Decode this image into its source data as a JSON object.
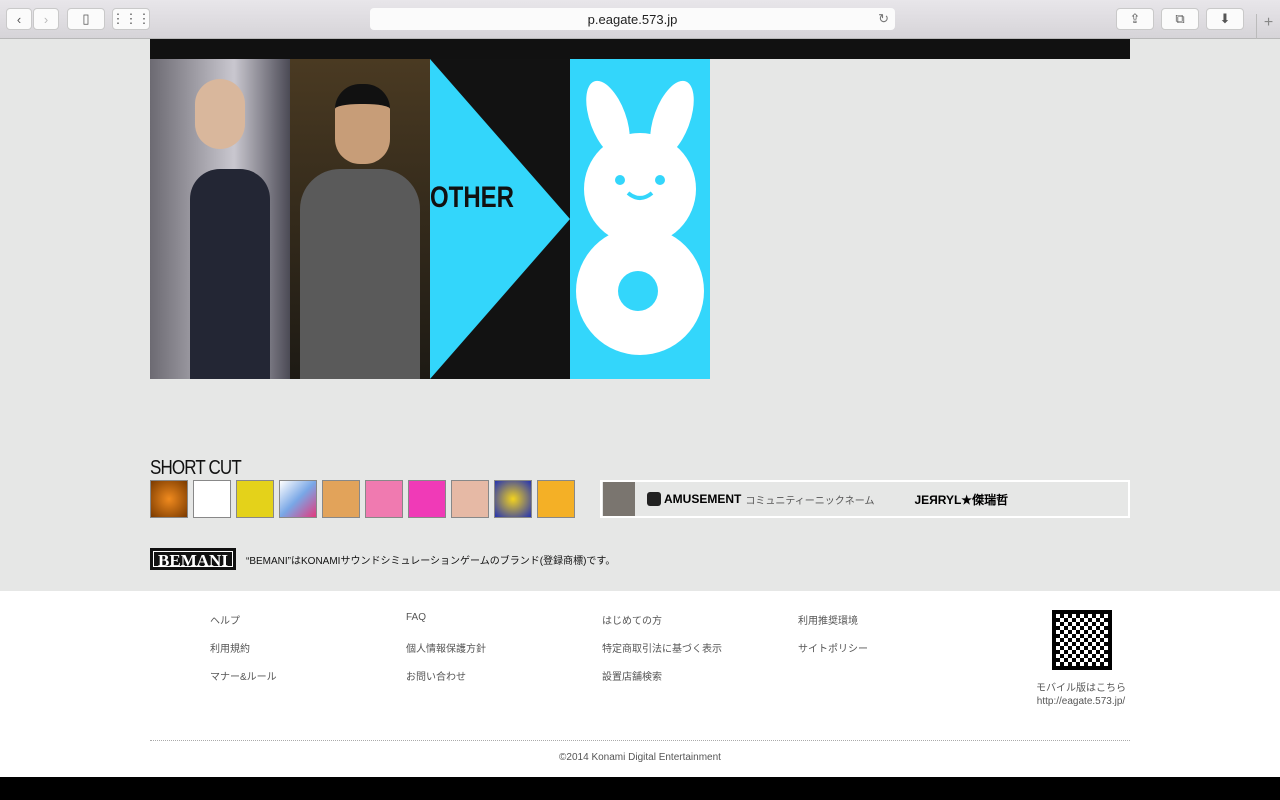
{
  "browser": {
    "url": "p.eagate.573.jp"
  },
  "banner": {
    "other_label": "OTHER"
  },
  "shortcut": {
    "title": "SHORT CUT",
    "icons": [
      "iidx",
      "ddr",
      "popn-mouse",
      "reflec-beat",
      "gitadora-girl",
      "sound-voltex",
      "jubeat-girl",
      "dance-evolution",
      "taiko-drumania",
      "nostalgia-girl"
    ],
    "amusement_logo": "AMUSEMENT",
    "nickname_label": "コミュニティーニックネーム",
    "nickname": "JEЯRYL★傑瑞哲"
  },
  "bemani": {
    "logo": "BEMANI",
    "notice": "“BEMANI”はKONAMIサウンドシミュレーションゲームのブランド(登録商標)です。"
  },
  "footer": {
    "columns": [
      [
        "ヘルプ",
        "利用規約",
        "マナー&ルール"
      ],
      [
        "FAQ",
        "個人情報保護方針",
        "お問い合わせ"
      ],
      [
        "はじめての方",
        "特定商取引法に基づく表示",
        "設置店舗検索"
      ],
      [
        "利用推奨環境",
        "サイトポリシー"
      ]
    ],
    "mobile_label": "モバイル版はこちら",
    "mobile_url": "http://eagate.573.jp/",
    "copyright": "©2014 Konami Digital Entertainment"
  },
  "colors": {
    "cyan": "#33d6fb"
  }
}
